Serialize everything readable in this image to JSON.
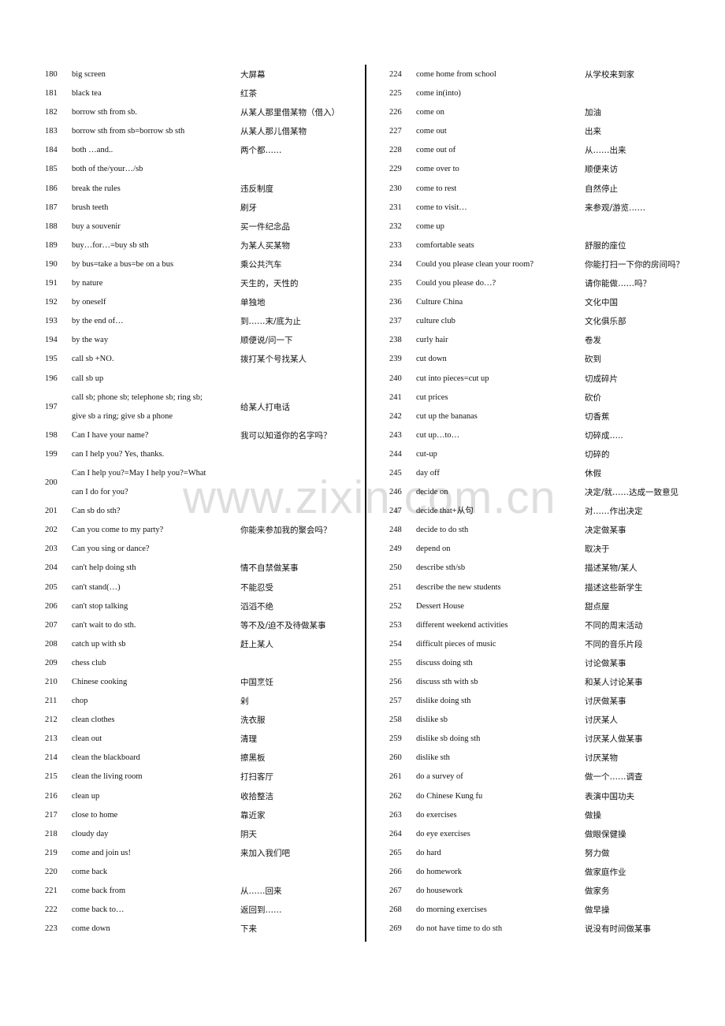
{
  "watermark": "www.zixin.com.cn",
  "left_column": [
    {
      "num": "180",
      "en": [
        "big screen"
      ],
      "zh": "大屏幕"
    },
    {
      "num": "181",
      "en": [
        "black tea"
      ],
      "zh": "红茶"
    },
    {
      "num": "182",
      "en": [
        "borrow sth from sb."
      ],
      "zh": "从某人那里借某物（借入）"
    },
    {
      "num": "183",
      "en": [
        "borrow sth from sb=borrow sb sth"
      ],
      "zh": "从某人那儿借某物"
    },
    {
      "num": "184",
      "en": [
        "both …and.."
      ],
      "zh": "两个都……"
    },
    {
      "num": "185",
      "en": [
        "both of the/your…/sb"
      ],
      "zh": ""
    },
    {
      "num": "186",
      "en": [
        "break the rules"
      ],
      "zh": "违反制度"
    },
    {
      "num": "187",
      "en": [
        "brush teeth"
      ],
      "zh": "刷牙"
    },
    {
      "num": "188",
      "en": [
        "buy a souvenir"
      ],
      "zh": "买一件纪念品"
    },
    {
      "num": "189",
      "en": [
        "buy…for…=buy sb sth"
      ],
      "zh": "为某人买某物"
    },
    {
      "num": "190",
      "en": [
        "by bus=take a bus=be on a bus"
      ],
      "zh": "乘公共汽车"
    },
    {
      "num": "191",
      "en": [
        "by nature"
      ],
      "zh": "天生的，天性的"
    },
    {
      "num": "192",
      "en": [
        "by oneself"
      ],
      "zh": "单独地"
    },
    {
      "num": "193",
      "en": [
        "by the end of…"
      ],
      "zh": "到……末/底为止"
    },
    {
      "num": "194",
      "en": [
        "by the way"
      ],
      "zh": "顺便说/问一下"
    },
    {
      "num": "195",
      "en": [
        "call sb +NO."
      ],
      "zh": "拨打某个号找某人"
    },
    {
      "num": "196",
      "en": [
        "call sb up"
      ],
      "zh": ""
    },
    {
      "num": "197",
      "en": [
        "call sb; phone sb; telephone sb; ring sb;",
        "give sb a ring;    give sb a phone"
      ],
      "zh": "给某人打电话"
    },
    {
      "num": "198",
      "en": [
        "Can I have your name?"
      ],
      "zh": "我可以知道你的名字吗？"
    },
    {
      "num": "199",
      "en": [
        "can I help you? Yes, thanks."
      ],
      "zh": ""
    },
    {
      "num": "200",
      "en": [
        "Can I help you?=May I help you?=What",
        "can I do for you?"
      ],
      "zh": ""
    },
    {
      "num": "201",
      "en": [
        "Can sb do sth?"
      ],
      "zh": ""
    },
    {
      "num": "202",
      "en": [
        "Can you come to my party?"
      ],
      "zh": "你能来参加我的聚会吗？"
    },
    {
      "num": "203",
      "en": [
        "Can you sing or dance?"
      ],
      "zh": ""
    },
    {
      "num": "204",
      "en": [
        "can't help doing sth"
      ],
      "zh": "情不自禁做某事"
    },
    {
      "num": "205",
      "en": [
        "can't stand(…)"
      ],
      "zh": "不能忍受"
    },
    {
      "num": "206",
      "en": [
        "can't stop talking"
      ],
      "zh": "滔滔不绝"
    },
    {
      "num": "207",
      "en": [
        "can't wait to do sth."
      ],
      "zh": "等不及/迫不及待做某事"
    },
    {
      "num": "208",
      "en": [
        "catch up with sb"
      ],
      "zh": "赶上某人"
    },
    {
      "num": "209",
      "en": [
        "chess club"
      ],
      "zh": ""
    },
    {
      "num": "210",
      "en": [
        "Chinese cooking"
      ],
      "zh": "中国烹饪"
    },
    {
      "num": "211",
      "en": [
        "chop"
      ],
      "zh": "剁"
    },
    {
      "num": "212",
      "en": [
        "clean clothes"
      ],
      "zh": "洗衣服"
    },
    {
      "num": "213",
      "en": [
        "clean out"
      ],
      "zh": "清理"
    },
    {
      "num": "214",
      "en": [
        "clean the blackboard"
      ],
      "zh": "擦黑板"
    },
    {
      "num": "215",
      "en": [
        "clean the living room"
      ],
      "zh": "打扫客厅"
    },
    {
      "num": "216",
      "en": [
        "clean up"
      ],
      "zh": "收拾整洁"
    },
    {
      "num": "217",
      "en": [
        "close to home"
      ],
      "zh": "靠近家"
    },
    {
      "num": "218",
      "en": [
        "cloudy day"
      ],
      "zh": "阴天"
    },
    {
      "num": "219",
      "en": [
        "come and join us!"
      ],
      "zh": "来加入我们吧"
    },
    {
      "num": "220",
      "en": [
        "come back"
      ],
      "zh": ""
    },
    {
      "num": "221",
      "en": [
        "come back from"
      ],
      "zh": "从……回来"
    },
    {
      "num": "222",
      "en": [
        "come back to…"
      ],
      "zh": "返回到……"
    },
    {
      "num": "223",
      "en": [
        "come down"
      ],
      "zh": "下来"
    }
  ],
  "right_column": [
    {
      "num": "224",
      "en": [
        "come home from school"
      ],
      "zh": "从学校来到家"
    },
    {
      "num": "225",
      "en": [
        "come in(into)"
      ],
      "zh": ""
    },
    {
      "num": "226",
      "en": [
        "come on"
      ],
      "zh": "加油"
    },
    {
      "num": "227",
      "en": [
        "come out"
      ],
      "zh": "出来"
    },
    {
      "num": "228",
      "en": [
        "come out of"
      ],
      "zh": "从……出来"
    },
    {
      "num": "229",
      "en": [
        "come over to"
      ],
      "zh": "顺便来访"
    },
    {
      "num": "230",
      "en": [
        "come to rest"
      ],
      "zh": "自然停止"
    },
    {
      "num": "231",
      "en": [
        "come to visit…"
      ],
      "zh": "来参观/游览……"
    },
    {
      "num": "232",
      "en": [
        "come up"
      ],
      "zh": ""
    },
    {
      "num": "233",
      "en": [
        "comfortable seats"
      ],
      "zh": "舒服的座位"
    },
    {
      "num": "234",
      "en": [
        "Could you please clean your room?"
      ],
      "zh": "你能打扫一下你的房间吗？"
    },
    {
      "num": "235",
      "en": [
        "Could you please do…?"
      ],
      "zh": "请你能做……吗？"
    },
    {
      "num": "236",
      "en": [
        "Culture China"
      ],
      "zh": "文化中国"
    },
    {
      "num": "237",
      "en": [
        "culture club"
      ],
      "zh": "文化俱乐部"
    },
    {
      "num": "238",
      "en": [
        "curly hair"
      ],
      "zh": "卷发"
    },
    {
      "num": "239",
      "en": [
        "cut down"
      ],
      "zh": "砍到"
    },
    {
      "num": "240",
      "en": [
        "cut into pieces=cut up"
      ],
      "zh": "切成碎片"
    },
    {
      "num": "241",
      "en": [
        "cut prices"
      ],
      "zh": "砍价"
    },
    {
      "num": "242",
      "en": [
        "cut up the bananas"
      ],
      "zh": "切香蕉"
    },
    {
      "num": "243",
      "en": [
        "cut up…to…"
      ],
      "zh": "切碎成….."
    },
    {
      "num": "244",
      "en": [
        "cut-up"
      ],
      "zh": "切碎的"
    },
    {
      "num": "245",
      "en": [
        "day off"
      ],
      "zh": "休假"
    },
    {
      "num": "246",
      "en": [
        "decide on"
      ],
      "zh": "决定/就……达成一致意见"
    },
    {
      "num": "247",
      "en": [
        "decide that+从句"
      ],
      "zh": "对……作出决定"
    },
    {
      "num": "248",
      "en": [
        "decide to do sth"
      ],
      "zh": "决定做某事"
    },
    {
      "num": "249",
      "en": [
        "depend on"
      ],
      "zh": "取决于"
    },
    {
      "num": "250",
      "en": [
        "describe sth/sb"
      ],
      "zh": "描述某物/某人"
    },
    {
      "num": "251",
      "en": [
        "describe the new students"
      ],
      "zh": "描述这些新学生"
    },
    {
      "num": "252",
      "en": [
        "Dessert House"
      ],
      "zh": "甜点屋"
    },
    {
      "num": "253",
      "en": [
        "different weekend activities"
      ],
      "zh": "不同的周末活动"
    },
    {
      "num": "254",
      "en": [
        "difficult pieces of music"
      ],
      "zh": "不同的音乐片段"
    },
    {
      "num": "255",
      "en": [
        "discuss doing sth"
      ],
      "zh": "讨论做某事"
    },
    {
      "num": "256",
      "en": [
        "discuss sth with sb"
      ],
      "zh": "和某人讨论某事"
    },
    {
      "num": "257",
      "en": [
        "dislike doing sth"
      ],
      "zh": "讨厌做某事"
    },
    {
      "num": "258",
      "en": [
        "dislike sb"
      ],
      "zh": "讨厌某人"
    },
    {
      "num": "259",
      "en": [
        "dislike sb doing sth"
      ],
      "zh": "讨厌某人做某事"
    },
    {
      "num": "260",
      "en": [
        "dislike sth"
      ],
      "zh": "讨厌某物"
    },
    {
      "num": "261",
      "en": [
        "do a survey of"
      ],
      "zh": "做一个……调查"
    },
    {
      "num": "262",
      "en": [
        "do Chinese Kung fu"
      ],
      "zh": "表演中国功夫"
    },
    {
      "num": "263",
      "en": [
        "do exercises"
      ],
      "zh": "做操"
    },
    {
      "num": "264",
      "en": [
        "do eye exercises"
      ],
      "zh": "做眼保健操"
    },
    {
      "num": "265",
      "en": [
        "do hard"
      ],
      "zh": "努力做"
    },
    {
      "num": "266",
      "en": [
        "do homework"
      ],
      "zh": "做家庭作业"
    },
    {
      "num": "267",
      "en": [
        "do housework"
      ],
      "zh": "做家务"
    },
    {
      "num": "268",
      "en": [
        "do morning exercises"
      ],
      "zh": "做早操"
    },
    {
      "num": "269",
      "en": [
        "do not have time to do sth"
      ],
      "zh": "说没有时间做某事"
    }
  ]
}
